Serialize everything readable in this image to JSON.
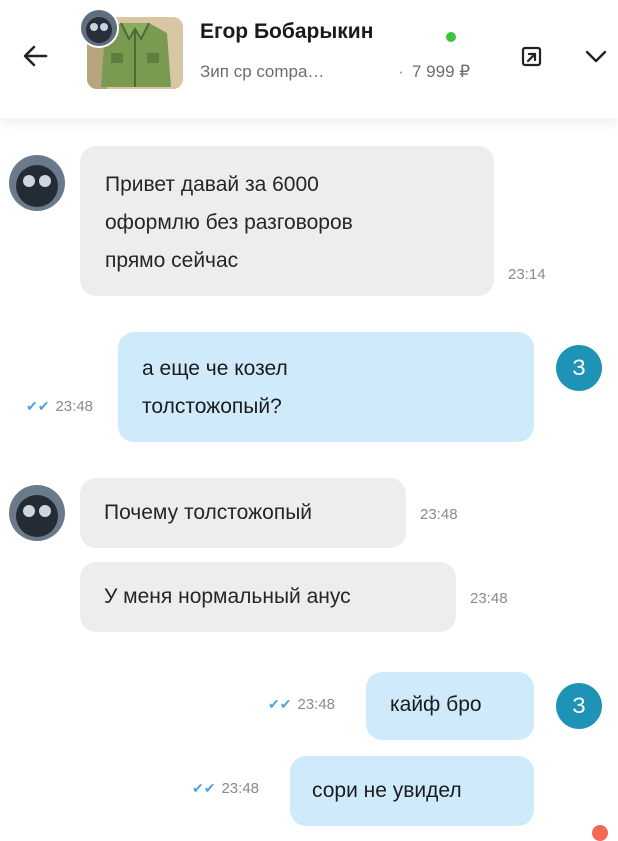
{
  "header": {
    "contact_name": "Егор Бобарыкин",
    "item_title": "Зип ср compa…",
    "item_separator": "·",
    "item_price": "7 999 ₽",
    "online_color": "#3cc43c"
  },
  "icons": {
    "back": "arrow-left-icon",
    "open_listing": "open-external-icon",
    "expand": "chevron-down-icon"
  },
  "messages": [
    {
      "direction": "in",
      "lines": [
        "Привет давай за 6000",
        "оформлю без разговоров",
        "прямо сейчас"
      ],
      "time": "23:14"
    },
    {
      "direction": "out",
      "lines": [
        "а еще че козел",
        "толстожопый?"
      ],
      "time": "23:48",
      "read": true,
      "avatar_letter": "З"
    },
    {
      "direction": "in",
      "lines": [
        "Почему толстожопый"
      ],
      "time": "23:48"
    },
    {
      "direction": "in",
      "lines": [
        "У меня нормальный анус"
      ],
      "time": "23:48"
    },
    {
      "direction": "out",
      "lines": [
        "кайф бро"
      ],
      "time": "23:48",
      "read": true,
      "avatar_letter": "З"
    },
    {
      "direction": "out",
      "lines": [
        "сори не увидел"
      ],
      "time": "23:48",
      "read": true
    }
  ],
  "colors": {
    "incoming_bubble": "#efedeb",
    "outgoing_bubble": "#cfebfb",
    "my_avatar": "#1f93b5",
    "read_check": "#4da3e0"
  }
}
